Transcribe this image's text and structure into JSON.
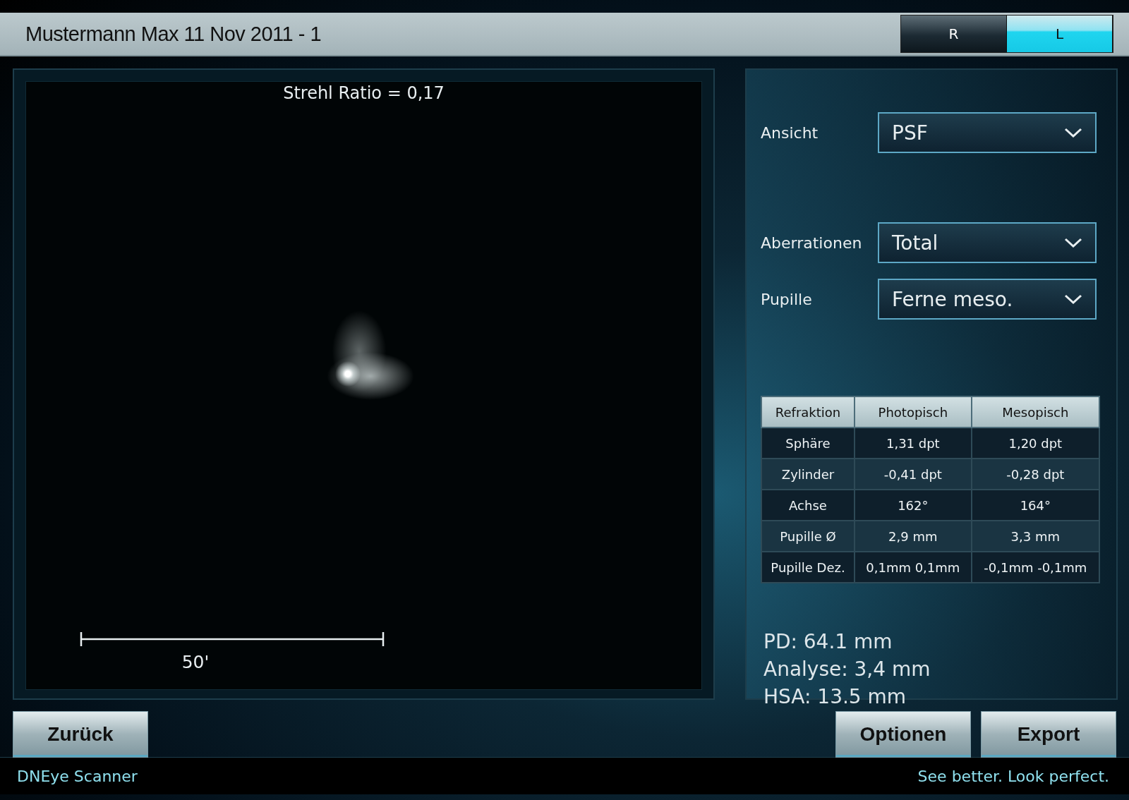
{
  "title": "Mustermann Max 11 Nov 2011 - 1",
  "eye_toggle": [
    {
      "label": "R",
      "selected": false
    },
    {
      "label": "L",
      "selected": true
    }
  ],
  "plot": {
    "title": "Strehl Ratio = 0,17",
    "scale_label": "50'"
  },
  "settings": [
    {
      "label": "Ansicht",
      "value": "PSF"
    },
    {
      "label": "Aberrationen",
      "value": "Total"
    },
    {
      "label": "Pupille",
      "value": "Ferne meso."
    }
  ],
  "table": {
    "columns": [
      "Refraktion",
      "Photopisch",
      "Mesopisch"
    ],
    "rows": [
      [
        "Sphäre",
        "1,31 dpt",
        "1,20 dpt"
      ],
      [
        "Zylinder",
        "-0,41 dpt",
        "-0,28 dpt"
      ],
      [
        "Achse",
        "162°",
        "164°"
      ],
      [
        "Pupille Ø",
        "2,9 mm",
        "3,3 mm"
      ],
      [
        "Pupille Dez.",
        "0,1mm 0,1mm",
        "-0,1mm -0,1mm"
      ]
    ]
  },
  "summary": [
    "PD: 64.1 mm",
    "Analyse: 3,4 mm",
    "HSA: 13.5 mm"
  ],
  "buttons": {
    "left": [
      "Zurück"
    ],
    "right": [
      "Optionen",
      "Export"
    ]
  },
  "footer": {
    "left": "DNEye Scanner",
    "right": "See better. Look perfect."
  }
}
